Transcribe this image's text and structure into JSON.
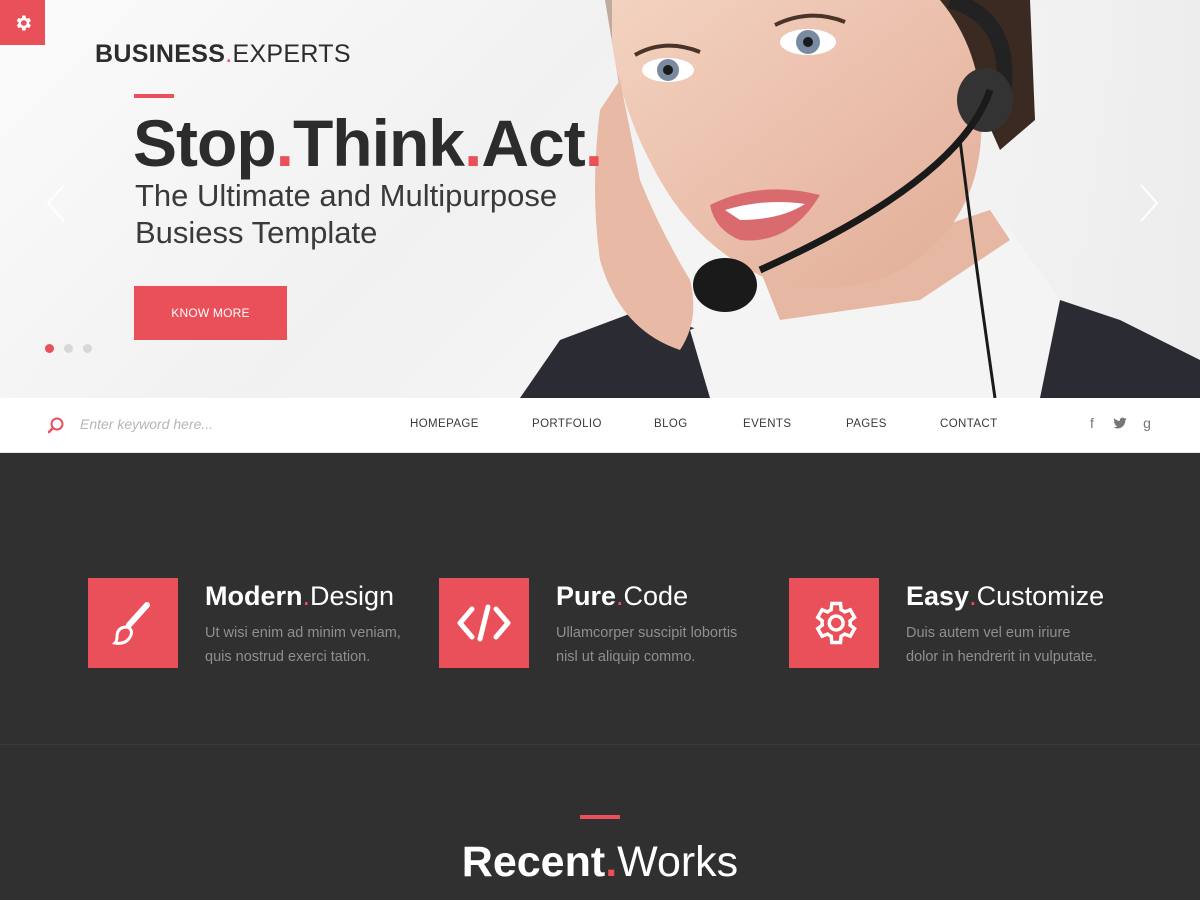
{
  "colors": {
    "accent": "#e9505a",
    "dark_bg": "#303030",
    "text_dark": "#2c2c2c"
  },
  "settings": {
    "icon": "gear-icon"
  },
  "logo": {
    "bold": "BUSINESS",
    "dot": ".",
    "light": "EXPERTS"
  },
  "hero": {
    "headline": {
      "w1": "Stop",
      "w2": "Think",
      "w3": "Act",
      "dot": "."
    },
    "subtitle_line1": "The Ultimate and Multipurpose",
    "subtitle_line2": "Busiess Template",
    "button_label": "KNOW MORE",
    "prev_icon": "chevron-left-icon",
    "next_icon": "chevron-right-icon",
    "slides": {
      "count": 3,
      "active": 1
    }
  },
  "search": {
    "placeholder": "Enter keyword here...",
    "value": "",
    "icon": "search-icon"
  },
  "nav": {
    "items": [
      {
        "label": "HOMEPAGE"
      },
      {
        "label": "PORTFOLIO"
      },
      {
        "label": "BLOG"
      },
      {
        "label": "EVENTS"
      },
      {
        "label": "PAGES"
      },
      {
        "label": "CONTACT"
      }
    ]
  },
  "social": [
    {
      "icon": "facebook-icon",
      "glyph": "f"
    },
    {
      "icon": "twitter-icon",
      "glyph": ""
    },
    {
      "icon": "google-plus-icon",
      "glyph": "g"
    }
  ],
  "features": [
    {
      "icon": "paintbrush-icon",
      "bold": "Modern",
      "dot": ".",
      "light": "Design",
      "desc1": "Ut wisi enim ad minim veniam,",
      "desc2": "quis nostrud exerci tation."
    },
    {
      "icon": "code-icon",
      "bold": "Pure",
      "dot": ".",
      "light": "Code",
      "desc1": "Ullamcorper suscipit lobortis",
      "desc2": "nisl ut aliquip commo."
    },
    {
      "icon": "gear-icon",
      "bold": "Easy",
      "dot": ".",
      "light": "Customize",
      "desc1": "Duis autem vel eum iriure",
      "desc2": "dolor in hendrerit in vulputate."
    }
  ],
  "recent": {
    "bold": "Recent",
    "dot": ".",
    "light": "Works"
  }
}
